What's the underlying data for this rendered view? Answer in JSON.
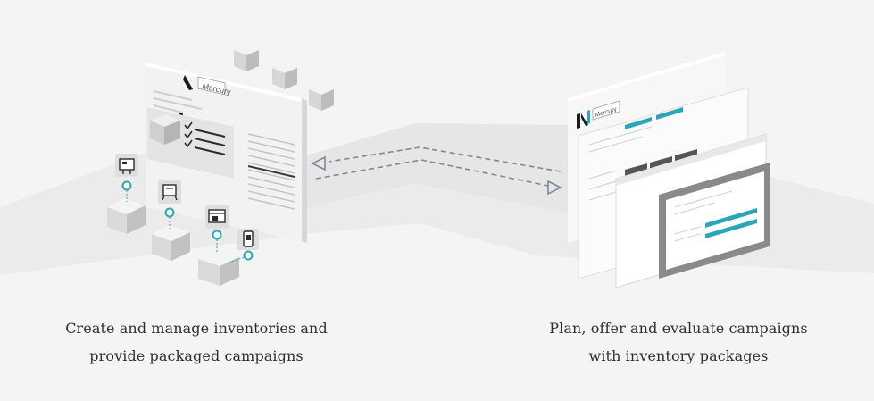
{
  "brand": {
    "name": "Mercury",
    "accent_color": "#2aa6b8",
    "logo_dark_color": "#1a1a1a"
  },
  "left_caption": {
    "line1": "Create and manage inventories and",
    "line2": "provide packaged campaigns"
  },
  "right_caption": {
    "line1": "Plan, offer and evaluate campaigns",
    "line2": "with inventory packages"
  },
  "inventory_icons": [
    "billboard-icon",
    "transit-stop-icon",
    "web-ad-icon",
    "mobile-ad-icon"
  ]
}
